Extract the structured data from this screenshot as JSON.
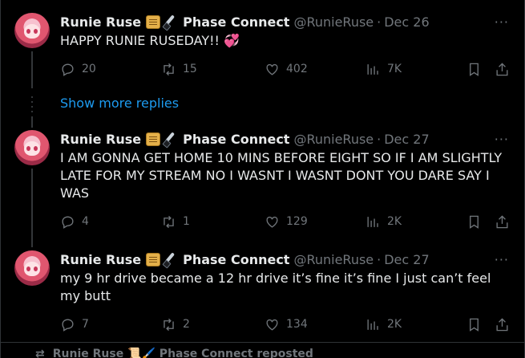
{
  "tweets": [
    {
      "name": "Runie Ruse",
      "display_suffix": "Phase Connect",
      "handle": "@RunieRuse",
      "separator": "·",
      "date": "Dec 26",
      "text": "HAPPY RUNIE RUSEDAY!! 💞",
      "replies": "20",
      "reposts": "15",
      "likes": "402",
      "views": "7K"
    },
    {
      "name": "Runie Ruse",
      "display_suffix": "Phase Connect",
      "handle": "@RunieRuse",
      "separator": "·",
      "date": "Dec 27",
      "text": "I AM GONNA GET HOME 10 MINS BEFORE EIGHT SO IF I AM SLIGHTLY LATE FOR MY STREAM NO I WASNT I WASNT DONT YOU DARE SAY I WAS",
      "replies": "4",
      "reposts": "1",
      "likes": "129",
      "views": "2K"
    },
    {
      "name": "Runie Ruse",
      "display_suffix": "Phase Connect",
      "handle": "@RunieRuse",
      "separator": "·",
      "date": "Dec 27",
      "text": "my 9 hr drive became a 12 hr drive it’s fine it’s fine I just can’t feel my butt",
      "replies": "7",
      "reposts": "2",
      "likes": "134",
      "views": "2K"
    }
  ],
  "show_more_replies": "Show more replies",
  "more_menu": "···",
  "reposted_banner": "Runie Ruse 📜🖌️ Phase Connect reposted",
  "icons": {
    "reply": "reply-icon",
    "repost": "repost-icon",
    "like": "heart-icon",
    "views": "views-icon",
    "bookmark": "bookmark-icon",
    "share": "share-icon",
    "more": "more-icon"
  },
  "colors": {
    "background": "#000000",
    "text": "#e7e9ea",
    "muted": "#71767b",
    "link": "#1d9bf0",
    "border": "#2f3336"
  }
}
